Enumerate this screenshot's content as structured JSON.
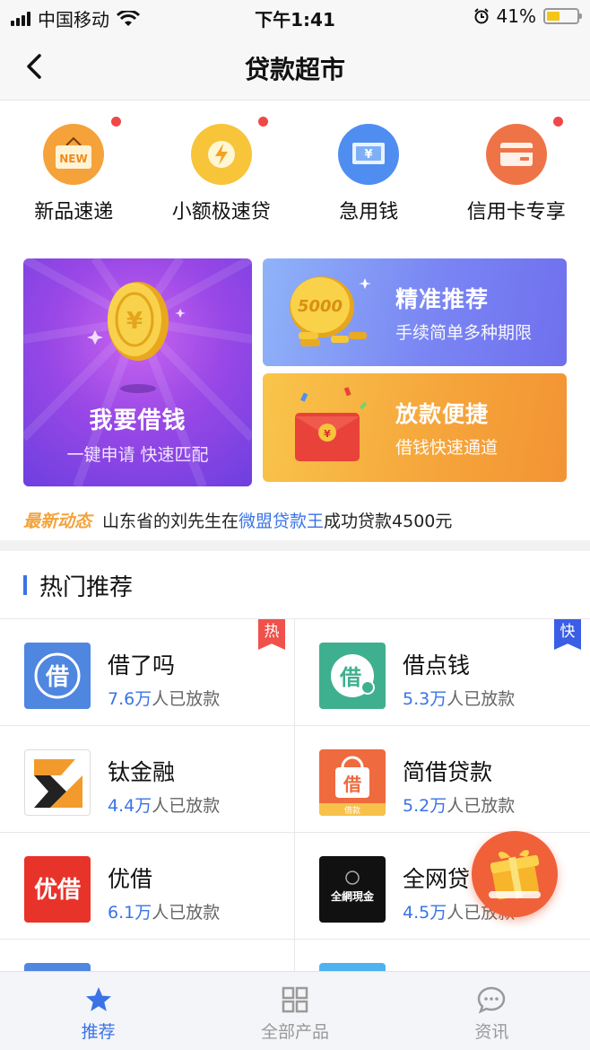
{
  "status_bar": {
    "carrier": "中国移动",
    "time": "下午1:41",
    "battery": "41%"
  },
  "nav": {
    "title": "贷款超市"
  },
  "categories": [
    {
      "label": "新品速递",
      "icon": "new-tag-icon",
      "color": "#f5a23a",
      "badge_text": "NEW",
      "dot": true
    },
    {
      "label": "小额极速贷",
      "icon": "lightning-icon",
      "color": "#f7c43a",
      "dot": true
    },
    {
      "label": "急用钱",
      "icon": "yuan-bill-icon",
      "color": "#4f8ef0",
      "badge_text": "¥",
      "dot": false
    },
    {
      "label": "信用卡专享",
      "icon": "credit-card-icon",
      "color": "#ee7448",
      "dot": true
    }
  ],
  "banners": {
    "main": {
      "title": "我要借钱",
      "subtitle": "一键申请 快速匹配"
    },
    "top_right": {
      "title": "精准推荐",
      "subtitle": "手续简单多种期限",
      "coin_text": "5000"
    },
    "bottom_right": {
      "title": "放款便捷",
      "subtitle": "借钱快速通道"
    }
  },
  "ticker": {
    "tag": "最新动态",
    "before": "山东省的刘先生在",
    "link": "微盟贷款王",
    "after": "成功贷款4500元"
  },
  "section": {
    "title": "热门推荐"
  },
  "products": [
    {
      "name": "借了吗",
      "count": "7.6万",
      "suffix": "人已放款",
      "badge": "热",
      "badge_color": "#f0514a",
      "logo": "jie-le-ma-logo"
    },
    {
      "name": "借点钱",
      "count": "5.3万",
      "suffix": "人已放款",
      "badge": "快",
      "badge_color": "#3a5ee6",
      "logo": "jie-dian-qian-logo"
    },
    {
      "name": "钛金融",
      "count": "4.4万",
      "suffix": "人已放款",
      "logo": "tai-jin-rong-logo"
    },
    {
      "name": "简借贷款",
      "count": "5.2万",
      "suffix": "人已放款",
      "logo": "jian-jie-logo",
      "logo_caption": "借款"
    },
    {
      "name": "优借",
      "count": "6.1万",
      "suffix": "人已放款",
      "logo": "you-jie-logo",
      "logo_text": "优借"
    },
    {
      "name": "全网贷",
      "count": "4.5万",
      "suffix": "人已放款",
      "logo": "quan-wang-logo",
      "logo_text": "全網現金"
    }
  ],
  "tabs": [
    {
      "label": "推荐",
      "icon": "star-icon",
      "active": true
    },
    {
      "label": "全部产品",
      "icon": "grid-icon",
      "active": false
    },
    {
      "label": "资讯",
      "icon": "chat-bubble-icon",
      "active": false
    }
  ]
}
